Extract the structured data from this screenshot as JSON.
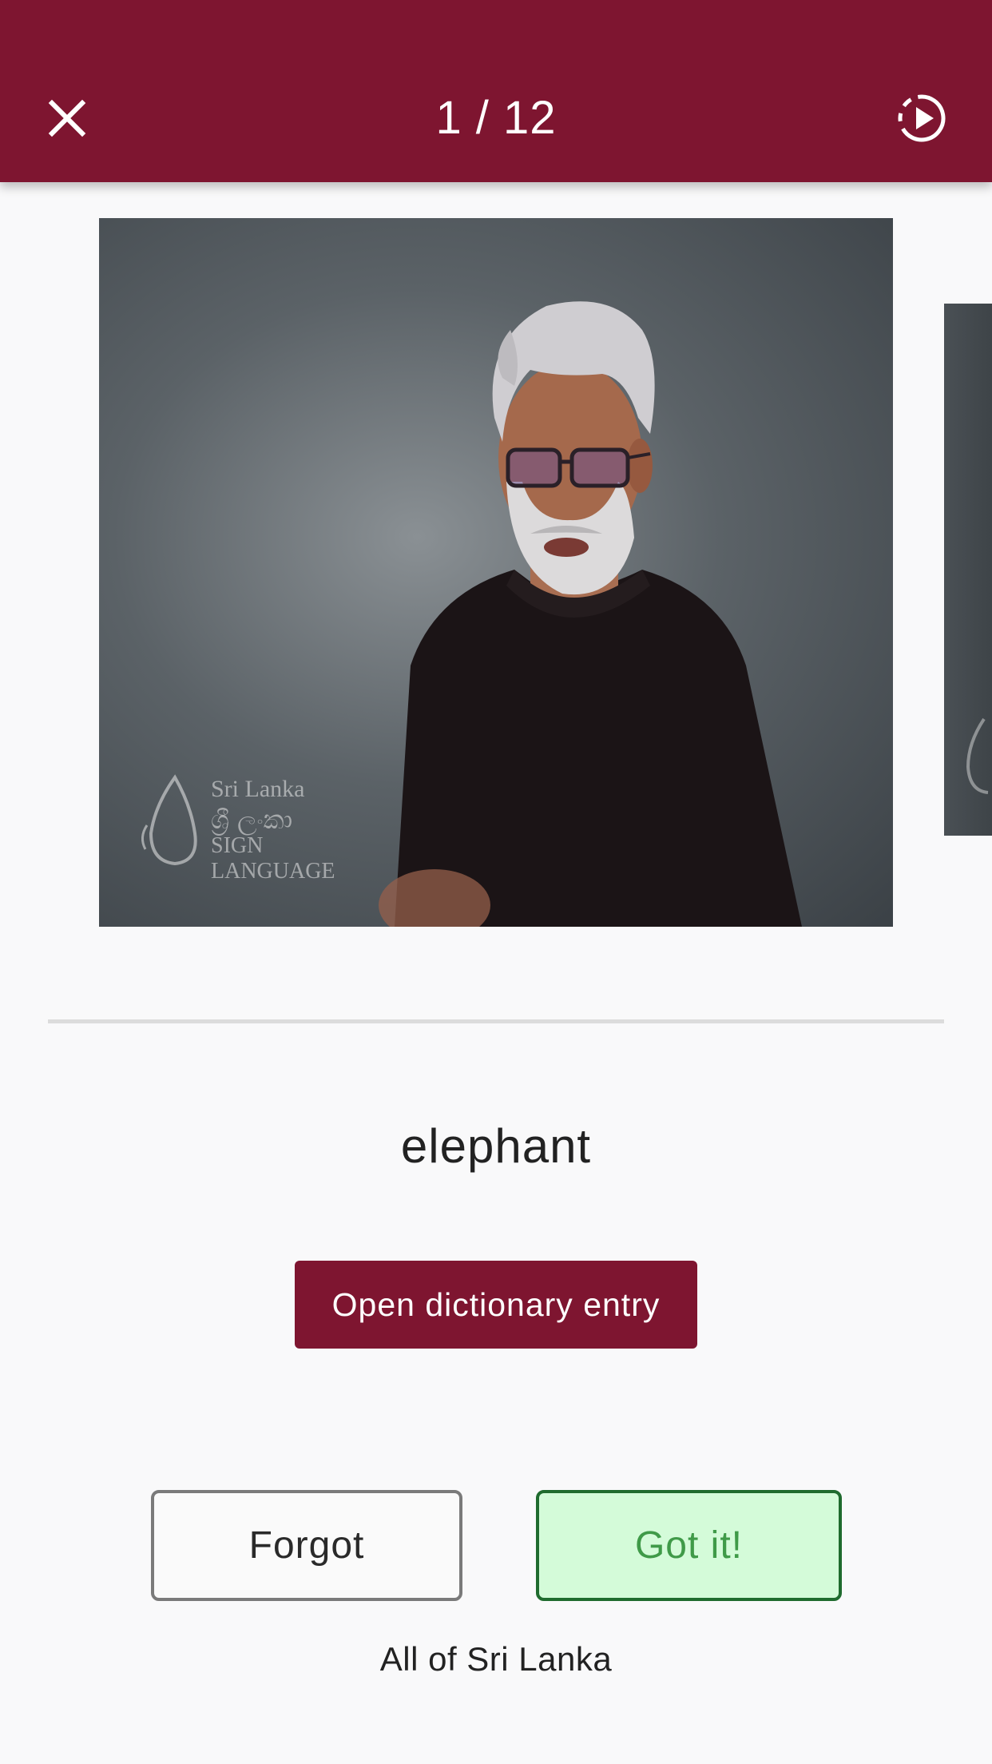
{
  "header": {
    "progress_text": "1 / 12",
    "close_icon": "close-icon",
    "autoplay_icon": "play-circle-dashed-icon",
    "background_color": "#7e1530"
  },
  "video": {
    "watermark": {
      "line1": "Sri Lanka",
      "line2": "ශ්‍රී ලංකා",
      "line3": "SIGN LANGUAGE"
    }
  },
  "card": {
    "word": "elephant",
    "dictionary_button_label": "Open dictionary entry"
  },
  "actions": {
    "forgot_label": "Forgot",
    "got_it_label": "Got it!",
    "got_it_color": "#3f9a48",
    "got_it_background": "#d4fbd9"
  },
  "footer": {
    "region_text": "All of Sri Lanka"
  }
}
